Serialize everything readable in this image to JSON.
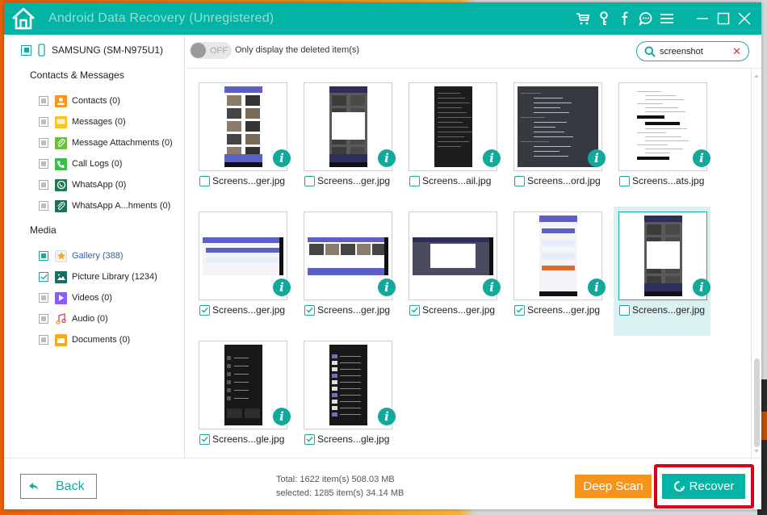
{
  "app": {
    "title": "Android Data Recovery (Unregistered)",
    "accent_color": "#03b4a5",
    "title_icons": [
      "cart-icon",
      "key-icon",
      "facebook-icon",
      "chat-icon",
      "menu-icon"
    ],
    "window_controls": [
      "minimize-icon",
      "maximize-icon",
      "close-icon"
    ]
  },
  "sidebar": {
    "device": {
      "label": "SAMSUNG (SM-N975U1)",
      "state": "partial"
    },
    "sections": [
      {
        "title": "Contacts & Messages",
        "items": [
          {
            "label": "Contacts (0)",
            "icon": "contacts-icon",
            "state": "partial"
          },
          {
            "label": "Messages (0)",
            "icon": "messages-icon",
            "state": "partial"
          },
          {
            "label": "Message Attachments (0)",
            "icon": "attachment-icon",
            "state": "partial"
          },
          {
            "label": "Call Logs (0)",
            "icon": "phone-icon",
            "state": "partial"
          },
          {
            "label": "WhatsApp (0)",
            "icon": "whatsapp-icon",
            "state": "partial"
          },
          {
            "label": "WhatsApp A...hments (0)",
            "icon": "whatsapp-attachment-icon",
            "state": "partial"
          }
        ]
      },
      {
        "title": "Media",
        "items": [
          {
            "label": "Gallery (388)",
            "icon": "star-icon",
            "state": "partial-active",
            "active": true
          },
          {
            "label": "Picture Library (1234)",
            "icon": "picture-icon",
            "state": "checked"
          },
          {
            "label": "Videos (0)",
            "icon": "video-icon",
            "state": "partial"
          },
          {
            "label": "Audio (0)",
            "icon": "audio-icon",
            "state": "partial"
          },
          {
            "label": "Documents (0)",
            "icon": "folder-icon",
            "state": "partial"
          }
        ]
      }
    ]
  },
  "toolbar": {
    "toggle_state": "OFF",
    "toggle_label": "Only display the deleted item(s)",
    "search_value": "screenshot",
    "search_placeholder": ""
  },
  "grid": {
    "items": [
      {
        "name": "Screens...ger.jpg",
        "checked": false,
        "thumb": "phone-gallery"
      },
      {
        "name": "Screens...ger.jpg",
        "checked": false,
        "thumb": "phone-dialog"
      },
      {
        "name": "Screens...ail.jpg",
        "checked": false,
        "thumb": "phone-email"
      },
      {
        "name": "Screens...ord.jpg",
        "checked": false,
        "thumb": "square-chat"
      },
      {
        "name": "Screens...ats.jpg",
        "checked": false,
        "thumb": "doc-list"
      },
      {
        "name": "Screens...ger.jpg",
        "checked": true,
        "thumb": "land-settings"
      },
      {
        "name": "Screens...ger.jpg",
        "checked": true,
        "thumb": "land-gallery"
      },
      {
        "name": "Screens...ger.jpg",
        "checked": true,
        "thumb": "land-dialog"
      },
      {
        "name": "Screens...ger.jpg",
        "checked": true,
        "thumb": "phone-settings"
      },
      {
        "name": "Screens...ger.jpg",
        "checked": false,
        "thumb": "phone-dialog",
        "selected": true
      },
      {
        "name": "Screens...gle.jpg",
        "checked": true,
        "thumb": "phone-files"
      },
      {
        "name": "Screens...gle.jpg",
        "checked": true,
        "thumb": "phone-list"
      }
    ]
  },
  "footer": {
    "back_label": "Back",
    "total_text": "Total: 1622 item(s) 508.03 MB",
    "selected_text": "selected: 1285 item(s) 34.14 MB",
    "deep_scan_label": "Deep Scan",
    "recover_label": "Recover",
    "deep_scan_color": "#f7941e",
    "highlight_color": "#d9001a"
  }
}
